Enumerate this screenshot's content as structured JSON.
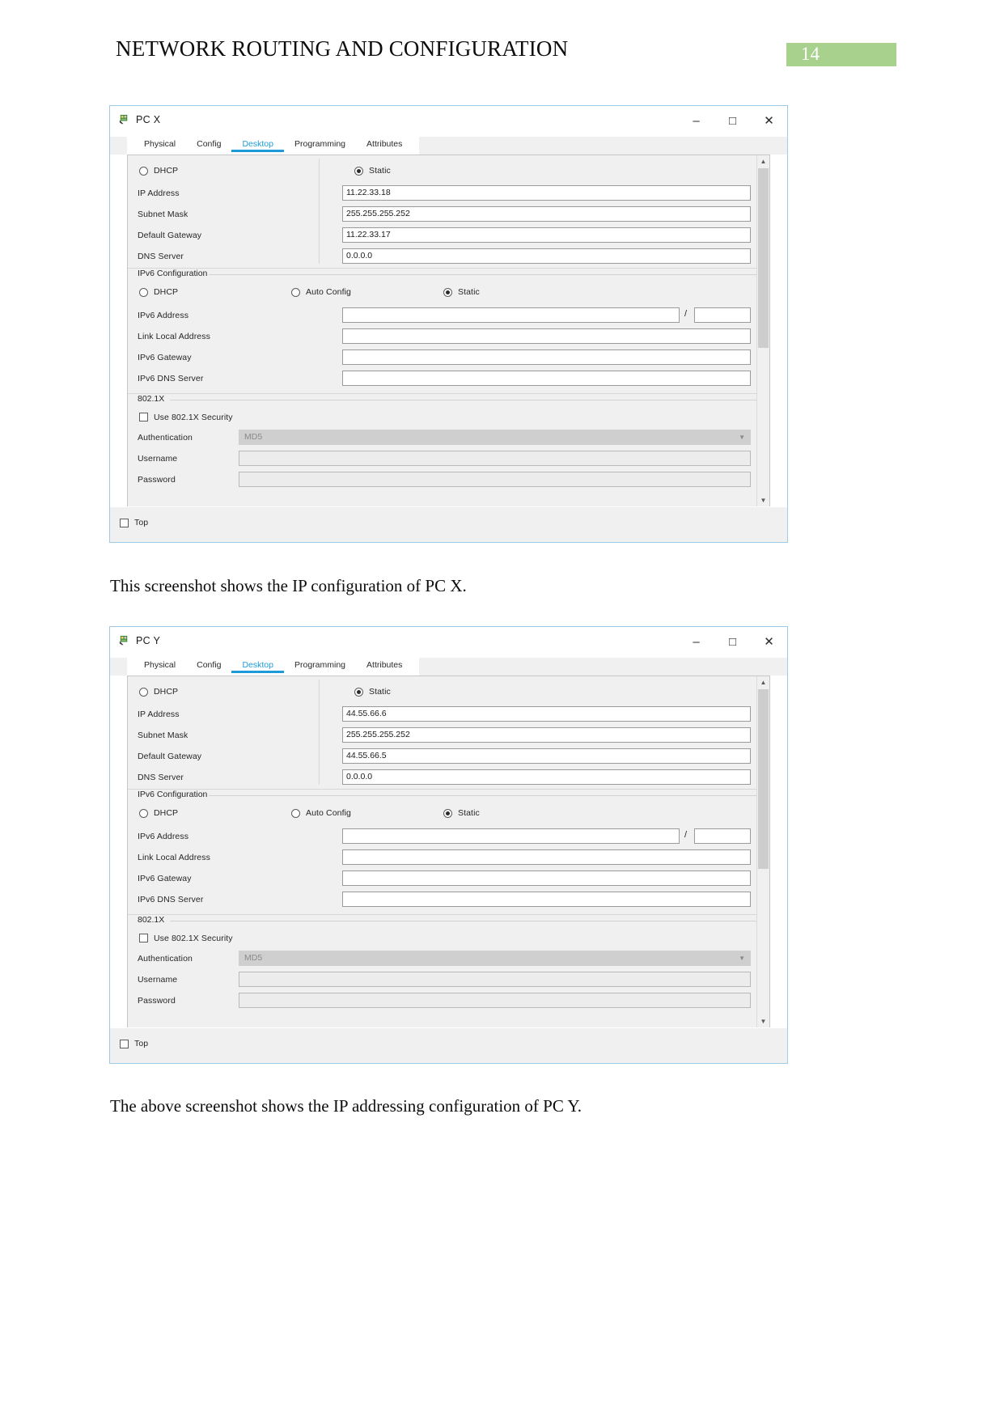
{
  "header": {
    "title": "NETWORK ROUTING AND CONFIGURATION",
    "page_number": "14",
    "badge_color": "#a9d18e"
  },
  "captions": {
    "first": "This screenshot shows the IP configuration of PC X.",
    "second": "The above screenshot shows the IP addressing configuration of PC Y."
  },
  "window_buttons": {
    "minimize": "–",
    "maximize": "□",
    "close": "✕"
  },
  "tabs": [
    {
      "label": "Physical",
      "active": false
    },
    {
      "label": "Config",
      "active": false
    },
    {
      "label": "Desktop",
      "active": true
    },
    {
      "label": "Programming",
      "active": false
    },
    {
      "label": "Attributes",
      "active": false
    }
  ],
  "labels": {
    "dhcp": "DHCP",
    "static": "Static",
    "auto_config": "Auto Config",
    "ip_address": "IP Address",
    "subnet_mask": "Subnet Mask",
    "default_gateway": "Default Gateway",
    "dns_server": "DNS Server",
    "ipv6_configuration": "IPv6 Configuration",
    "ipv6_address": "IPv6 Address",
    "link_local_address": "Link Local Address",
    "ipv6_gateway": "IPv6 Gateway",
    "ipv6_dns_server": "IPv6 DNS Server",
    "dot1x": "802.1X",
    "use_dot1x_security": "Use 802.1X Security",
    "authentication": "Authentication",
    "username": "Username",
    "password": "Password",
    "top": "Top",
    "slash": "/"
  },
  "accent_color": "#1d9bd8",
  "windows": [
    {
      "id": "pcx",
      "title": "PC X",
      "ipv4": {
        "mode": "Static",
        "dhcp_selected": false,
        "static_selected": true,
        "ip_address": "11.22.33.18",
        "subnet_mask": "255.255.255.252",
        "default_gateway": "11.22.33.17",
        "dns_server": "0.0.0.0"
      },
      "ipv6": {
        "dhcp_selected": false,
        "auto_config_selected": false,
        "static_selected": true,
        "ipv6_address": "",
        "ipv6_prefix": "",
        "link_local_address": "",
        "ipv6_gateway": "",
        "ipv6_dns_server": ""
      },
      "dot1x": {
        "use_security_checked": false,
        "authentication": "MD5",
        "username": "",
        "password": ""
      },
      "top_checked": false
    },
    {
      "id": "pcy",
      "title": "PC Y",
      "ipv4": {
        "mode": "Static",
        "dhcp_selected": false,
        "static_selected": true,
        "ip_address": "44.55.66.6",
        "subnet_mask": "255.255.255.252",
        "default_gateway": "44.55.66.5",
        "dns_server": "0.0.0.0"
      },
      "ipv6": {
        "dhcp_selected": false,
        "auto_config_selected": false,
        "static_selected": true,
        "ipv6_address": "",
        "ipv6_prefix": "",
        "link_local_address": "",
        "ipv6_gateway": "",
        "ipv6_dns_server": ""
      },
      "dot1x": {
        "use_security_checked": false,
        "authentication": "MD5",
        "username": "",
        "password": ""
      },
      "top_checked": false
    }
  ]
}
